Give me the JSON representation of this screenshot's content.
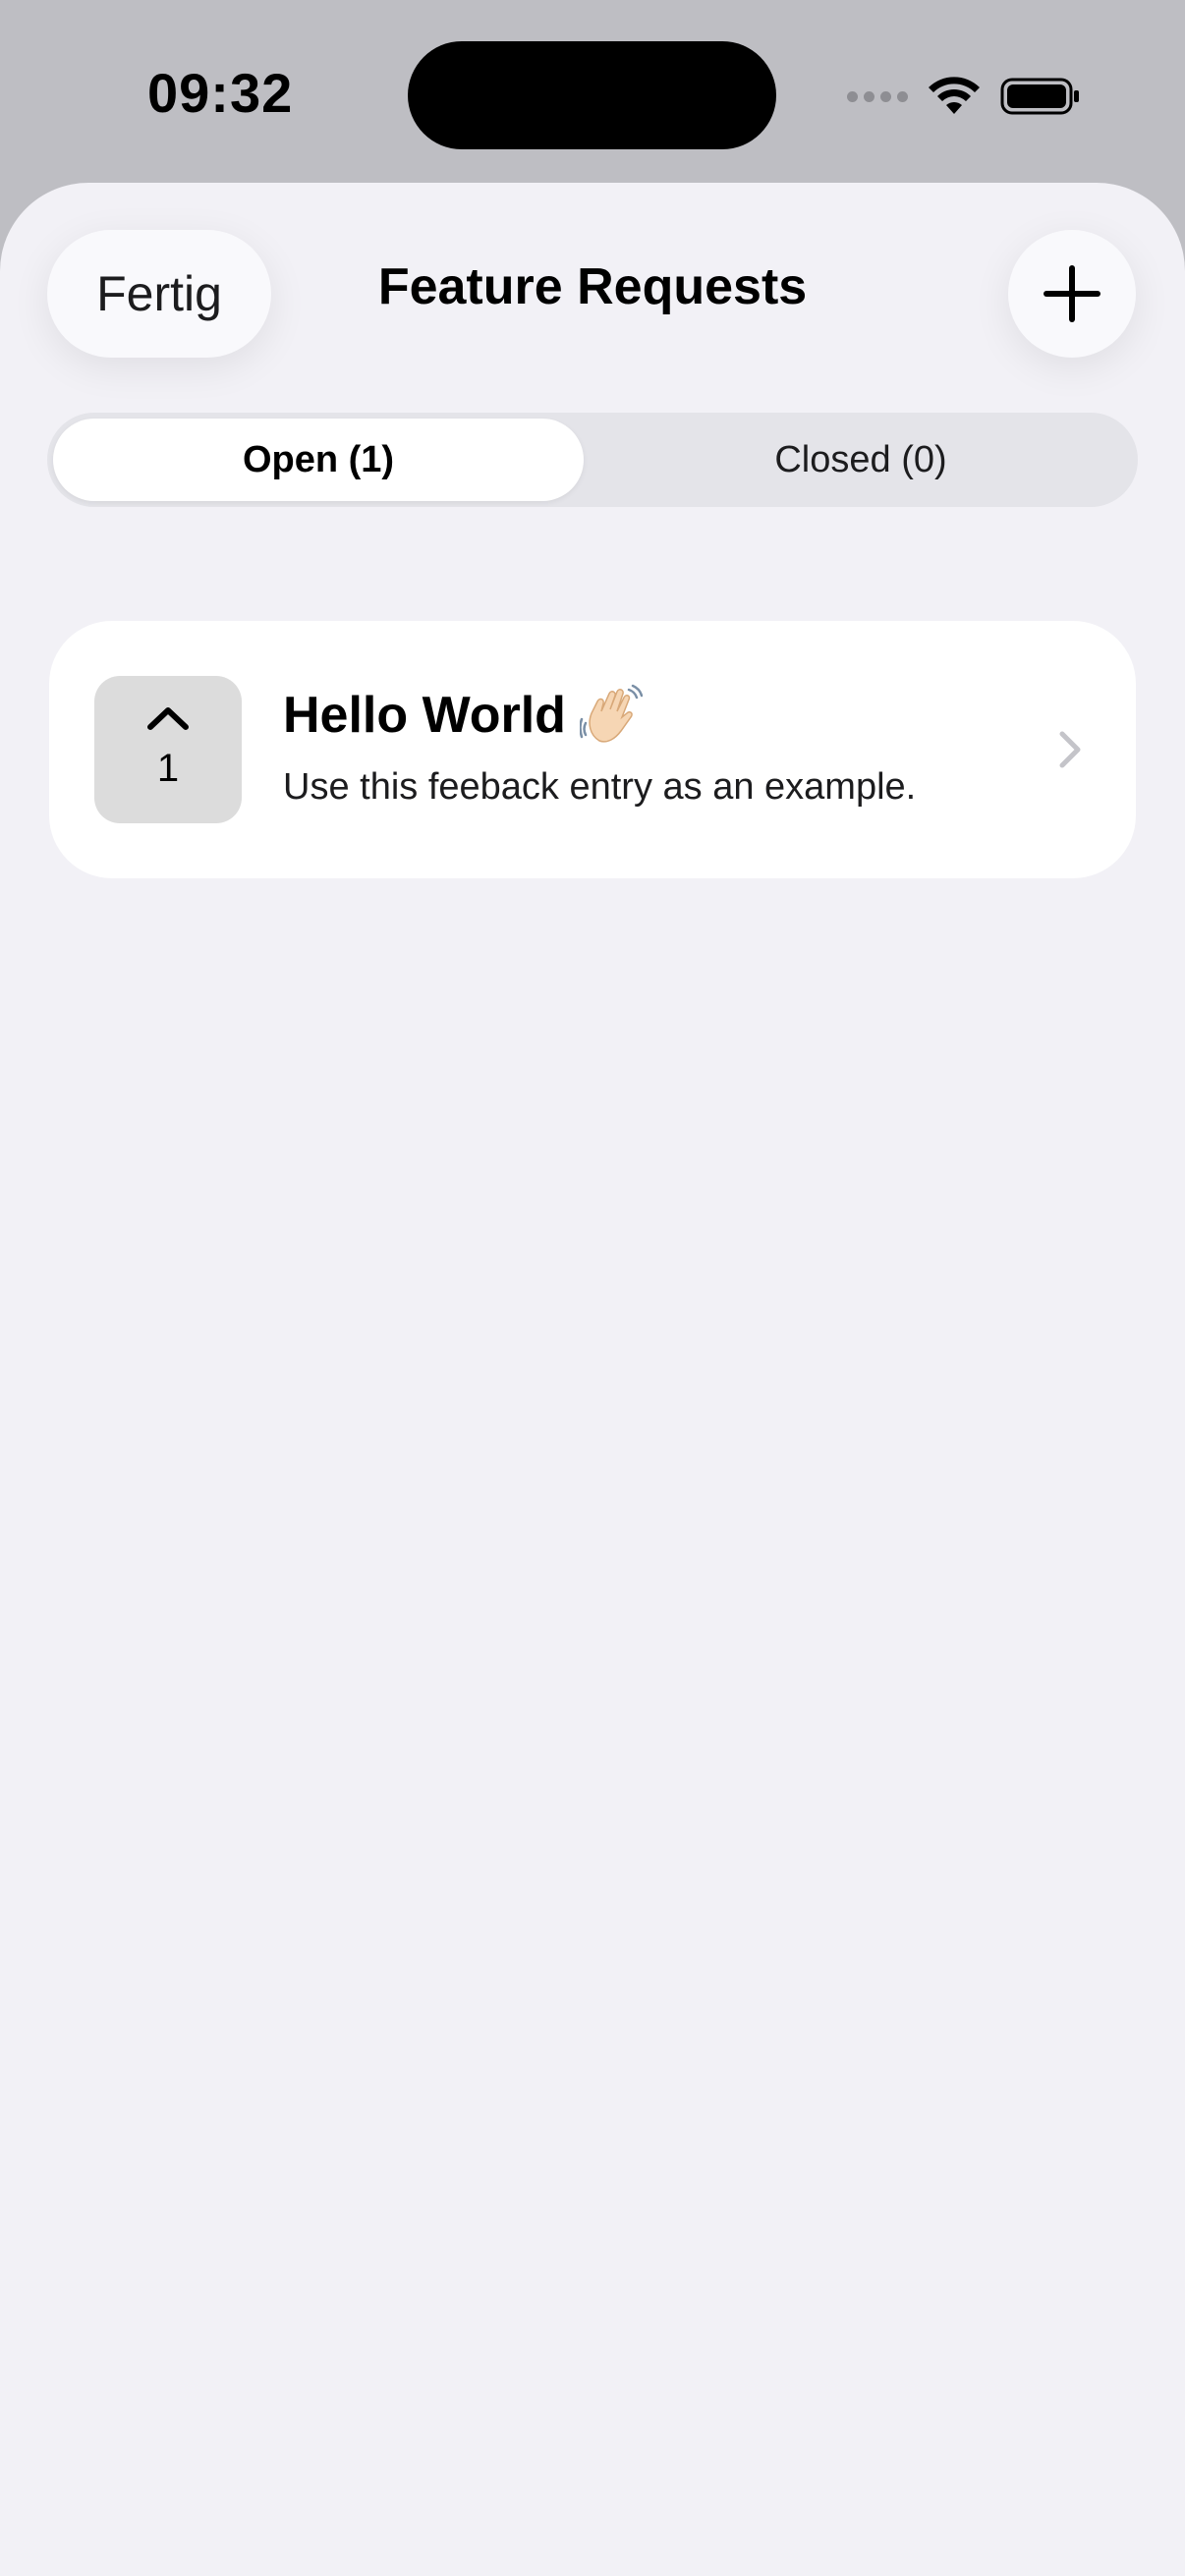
{
  "status_bar": {
    "time": "09:32"
  },
  "nav": {
    "done_label": "Fertig",
    "title": "Feature Requests",
    "add_icon": "plus-icon"
  },
  "segments": {
    "open_label": "Open (1)",
    "closed_label": "Closed (0)",
    "selected": "open"
  },
  "requests": [
    {
      "title": "Hello World",
      "emoji_icon": "waving-hand-icon",
      "description": "Use this feeback entry as an example.",
      "votes": "1"
    }
  ],
  "colors": {
    "sheet_background": "#f2f1f6",
    "card_background": "#ffffff",
    "vote_box": "#dcdcdc",
    "segment_track": "#e4e4e9"
  }
}
